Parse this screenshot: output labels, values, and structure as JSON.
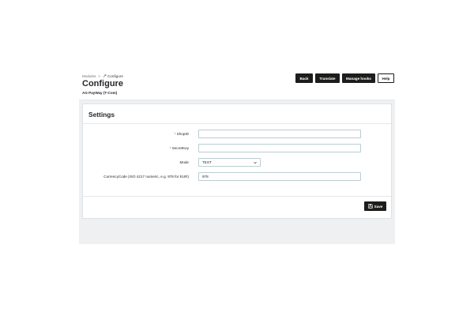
{
  "breadcrumb": {
    "parent": "Modules",
    "separator": ">",
    "current": "Configure",
    "current_icon": "wrench-icon"
  },
  "header": {
    "title": "Configure",
    "subtitle": "AG PayWay (T-Com)"
  },
  "toolbar": {
    "back": "Back",
    "translate": "Translate",
    "manage_hooks": "Manage hooks",
    "help": "Help"
  },
  "settings": {
    "title": "Settings",
    "shop_id": {
      "required_mark": "*",
      "label": "ShopID",
      "value": ""
    },
    "secret_key": {
      "required_mark": "*",
      "label": "SecretKey",
      "value": ""
    },
    "mode": {
      "label": "Mode",
      "selected": "TEST",
      "icon": "chevron-down-icon"
    },
    "currency_code": {
      "label": "CurrencyCode (ISO 4217 numeric, e.g. 978 for EUR)",
      "value": "978"
    },
    "save": "Save",
    "save_icon": "floppy-disk-icon"
  },
  "colors": {
    "button_dark": "#1d1d1b",
    "page_bg": "#eef0f1",
    "input_border": "#bbcdd2",
    "required": "#c0392b"
  }
}
